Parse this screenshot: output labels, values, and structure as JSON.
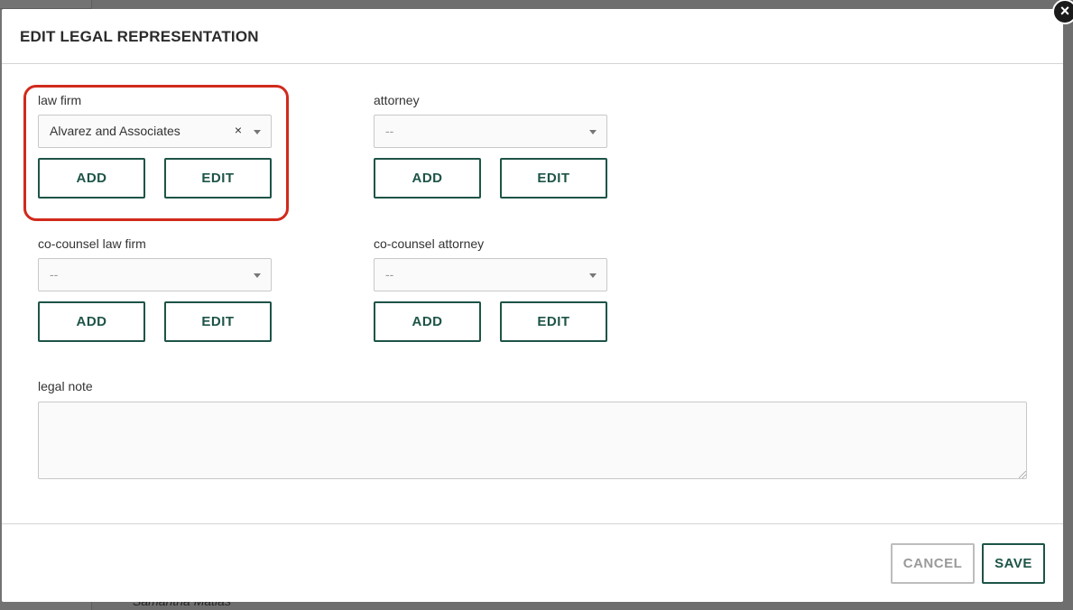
{
  "modal": {
    "title": "EDIT LEGAL REPRESENTATION",
    "close_symbol": "×"
  },
  "law_firm": {
    "label": "law firm",
    "value": "Alvarez and Associates",
    "clear_symbol": "×",
    "add_label": "ADD",
    "edit_label": "EDIT"
  },
  "attorney": {
    "label": "attorney",
    "placeholder": "--",
    "add_label": "ADD",
    "edit_label": "EDIT"
  },
  "co_counsel_law_firm": {
    "label": "co-counsel law firm",
    "placeholder": "--",
    "add_label": "ADD",
    "edit_label": "EDIT"
  },
  "co_counsel_attorney": {
    "label": "co-counsel attorney",
    "placeholder": "--",
    "add_label": "ADD",
    "edit_label": "EDIT"
  },
  "legal_note": {
    "label": "legal note",
    "value": ""
  },
  "footer": {
    "cancel_label": "CANCEL",
    "save_label": "SAVE"
  },
  "backdrop": {
    "partial_name": "Samantha Matias"
  },
  "colors": {
    "accent": "#1d5447",
    "highlight": "#d12a1c",
    "disabled": "#9a9a9a"
  }
}
